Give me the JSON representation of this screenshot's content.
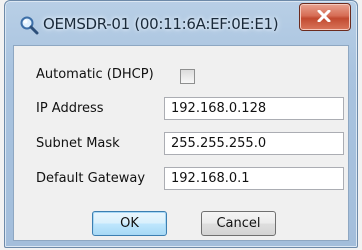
{
  "window": {
    "title": "OEMSDR-01 (00:11:6A:EF:0E:E1)",
    "title_icon": "magnifier-icon",
    "close_icon": "close-icon"
  },
  "form": {
    "automatic_dhcp": {
      "label": "Automatic (DHCP)",
      "checked": false
    },
    "ip_address": {
      "label": "IP Address",
      "value": "192.168.0.128"
    },
    "subnet_mask": {
      "label": "Subnet Mask",
      "value": "255.255.255.0"
    },
    "default_gateway": {
      "label": "Default Gateway",
      "value": "192.168.0.1"
    }
  },
  "buttons": {
    "ok_label": "OK",
    "cancel_label": "Cancel"
  },
  "colors": {
    "titlebar": "#a9c3df",
    "close_button": "#c9553b",
    "default_button_border": "#3c7fb1"
  }
}
